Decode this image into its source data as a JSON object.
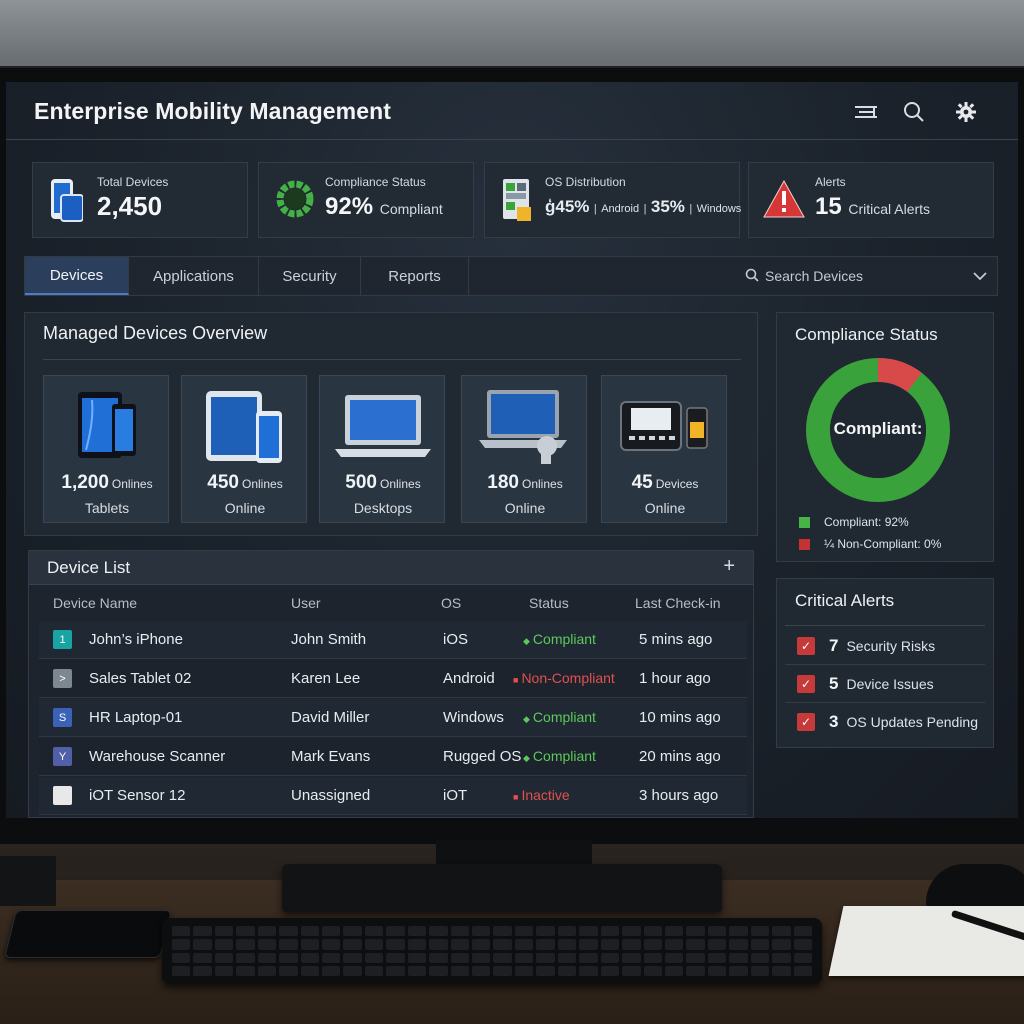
{
  "app": {
    "title": "Enterprise Mobility Management"
  },
  "header_icons": [
    "menu-icon",
    "search-icon",
    "gear-icon"
  ],
  "stats": {
    "total": {
      "label": "Total Devices",
      "value": "2,450"
    },
    "compliance": {
      "label": "Compliance Status",
      "value": "92%",
      "unit": "Compliant",
      "ring_text": "✓✓✓"
    },
    "os": {
      "label": "OS Distribution",
      "a_value": "ģ45%",
      "a_name": "Android",
      "b_value": "35%",
      "b_name": "Windows"
    },
    "alerts": {
      "label": "Alerts",
      "value": "15",
      "unit": "Critical Alerts"
    }
  },
  "tabs": [
    {
      "label": "Devices",
      "active": true
    },
    {
      "label": "Applications"
    },
    {
      "label": "Security"
    },
    {
      "label": "Reports"
    }
  ],
  "search": {
    "placeholder": "Search Devices"
  },
  "overview": {
    "title": "Managed Devices  Overview",
    "cards": [
      {
        "count": "1,200",
        "unit": "Onlines",
        "sub": "Tablets",
        "icon": "tablet-icon"
      },
      {
        "count": "450",
        "unit": "Onlines",
        "sub": "Online",
        "icon": "tablet-phone-icon"
      },
      {
        "count": "500",
        "unit": "Onlines",
        "sub": "Desktops",
        "icon": "laptop-icon"
      },
      {
        "count": "180",
        "unit": "Onlines",
        "sub": "Online",
        "icon": "laptop-scanner-icon"
      },
      {
        "count": "45",
        "unit": "Devices",
        "sub": "Online",
        "icon": "iot-device-icon"
      }
    ]
  },
  "device_list": {
    "title": "Device List",
    "add_label": "+",
    "columns": [
      "Device Name",
      "User",
      "OS",
      "Status",
      "Last Check-in"
    ],
    "rows": [
      {
        "name": "John’s iPhone",
        "user": "John Smith",
        "os": "iOS",
        "status": "Compliant",
        "status_kind": "ok",
        "checkin": "5 mins ago",
        "icon_glyph": "1",
        "icon_color": "#1aa3a3"
      },
      {
        "name": "Sales Tablet 02",
        "user": "Karen Lee",
        "os": "Android",
        "status": "Non-Compliant",
        "status_kind": "bad",
        "checkin": "1 hour ago",
        "icon_glyph": ">",
        "icon_color": "#7d8791"
      },
      {
        "name": "HR Laptop-01",
        "user": "David Miller",
        "os": "Windows",
        "status": "Compliant",
        "status_kind": "ok",
        "checkin": "10 mins ago",
        "icon_glyph": "S",
        "icon_color": "#3a63b8"
      },
      {
        "name": "Warehouse Scanner",
        "user": "Mark Evans",
        "os": "Rugged OS",
        "status": "Compliant",
        "status_kind": "ok",
        "checkin": "20 mins ago",
        "icon_glyph": "Y",
        "icon_color": "#4f5fa8"
      },
      {
        "name": "iOT Sensor 12",
        "user": "Unassigned",
        "os": "iOT",
        "status": "Inactive",
        "status_kind": "bad",
        "checkin": "3 hours ago",
        "icon_glyph": "",
        "icon_color": "#e8e8e8"
      }
    ]
  },
  "compliance_panel": {
    "title": "Compliance Status",
    "center": "Compliant:",
    "compliant_pct": 92,
    "legend": [
      {
        "label": "Compliant: 92%",
        "color": "#46b546"
      },
      {
        "label": "¼ Non-Compliant: 0%",
        "color": "#c43232"
      }
    ]
  },
  "critical_alerts": {
    "title": "Critical Alerts",
    "items": [
      {
        "count": "7",
        "label": "Security Risks"
      },
      {
        "count": "5",
        "label": "Device Issues"
      },
      {
        "count": "3",
        "label": "OS Updates Pending"
      }
    ]
  }
}
